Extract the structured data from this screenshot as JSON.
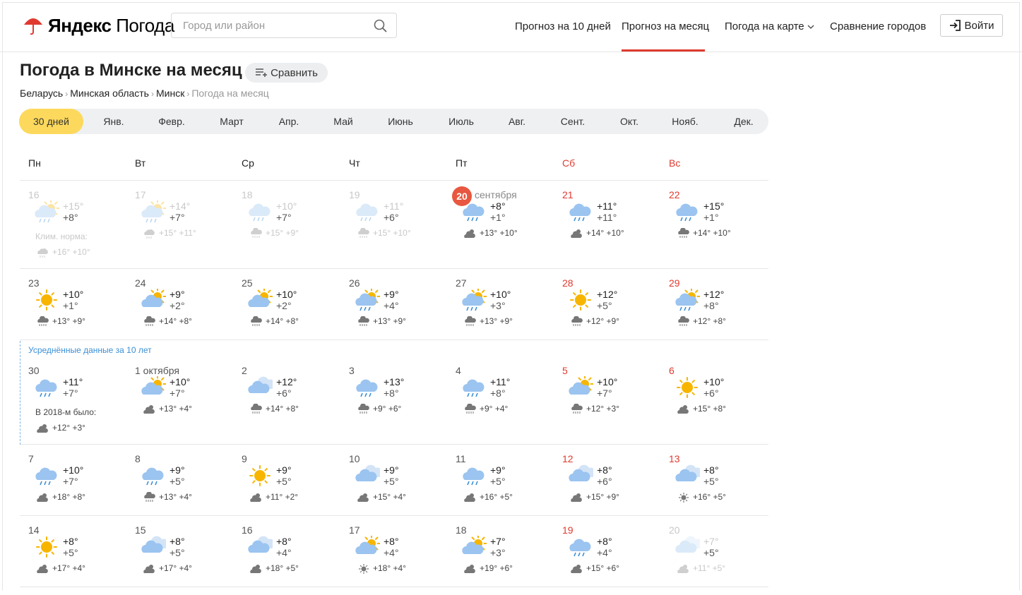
{
  "header": {
    "logo_brand": "Яндекс",
    "logo_service": "Погода",
    "search_placeholder": "Город или район",
    "nav": [
      "Прогноз на 10 дней",
      "Прогноз на месяц",
      "Погода на карте",
      "Сравнение городов"
    ],
    "login": "Войти"
  },
  "page": {
    "title": "Погода в Минске на месяц",
    "compare_label": "Сравнить",
    "breadcrumbs": [
      "Беларусь",
      "Минская область",
      "Минск",
      "Погода на месяц"
    ]
  },
  "months": [
    "30 дней",
    "Янв.",
    "Февр.",
    "Март",
    "Апр.",
    "Май",
    "Июнь",
    "Июль",
    "Авг.",
    "Сент.",
    "Окт.",
    "Нояб.",
    "Дек."
  ],
  "weekdays": [
    "Пн",
    "Вт",
    "Ср",
    "Чт",
    "Пт",
    "Сб",
    "Вс"
  ],
  "avg_label": "Усреднённые данные за 10 лет",
  "clim_label": "Клим. норма:",
  "clim_values": "+16° +10°",
  "past_year_label": "В 2018-м было:",
  "past_year_values": "+12° +3°",
  "today_month": "сентября",
  "colors": {
    "accent_yellow": "#fcd95c",
    "weekend_red": "#e03a2f",
    "today_badge": "#e8573f",
    "avg_blue": "#3b8fd6"
  },
  "weeks": [
    [
      {
        "n": "16",
        "d": "+15°",
        "nt": "+8°",
        "s": "",
        "i": "partly-cloudy-rain",
        "si": "sun-cloud-rain",
        "past": true
      },
      {
        "n": "17",
        "d": "+14°",
        "nt": "+7°",
        "s": "+15° +11°",
        "i": "partly-cloudy-rain",
        "si": "sun-cloud-rain",
        "past": true
      },
      {
        "n": "18",
        "d": "+10°",
        "nt": "+7°",
        "s": "+15° +9°",
        "i": "cloud-rain",
        "si": "cloud-rain",
        "past": true
      },
      {
        "n": "19",
        "d": "+11°",
        "nt": "+6°",
        "s": "+15° +10°",
        "i": "cloud-rain",
        "si": "cloud-rain",
        "past": true
      },
      {
        "n": "20",
        "d": "+8°",
        "nt": "+1°",
        "s": "+13° +10°",
        "i": "cloud-rain",
        "si": "sun-cloud",
        "today": true
      },
      {
        "n": "21",
        "d": "+11°",
        "nt": "+11°",
        "s": "+14° +10°",
        "i": "cloud-rain",
        "si": "sun-cloud"
      },
      {
        "n": "22",
        "d": "+15°",
        "nt": "+1°",
        "s": "+14° +10°",
        "i": "cloud-rain",
        "si": "cloud-rain"
      }
    ],
    [
      {
        "n": "23",
        "d": "+10°",
        "nt": "+1°",
        "s": "+13° +9°",
        "i": "sun",
        "si": "cloud-rain"
      },
      {
        "n": "24",
        "d": "+9°",
        "nt": "+2°",
        "s": "+14° +8°",
        "i": "partly-cloudy",
        "si": "cloud-rain"
      },
      {
        "n": "25",
        "d": "+10°",
        "nt": "+2°",
        "s": "+14° +8°",
        "i": "partly-cloudy",
        "si": "cloud-rain"
      },
      {
        "n": "26",
        "d": "+9°",
        "nt": "+4°",
        "s": "+13° +9°",
        "i": "partly-cloudy-rain",
        "si": "cloud-rain"
      },
      {
        "n": "27",
        "d": "+10°",
        "nt": "+3°",
        "s": "+13° +9°",
        "i": "partly-cloudy-rain",
        "si": "cloud-rain"
      },
      {
        "n": "28",
        "d": "+12°",
        "nt": "+5°",
        "s": "+12° +9°",
        "i": "sun",
        "si": "cloud-rain"
      },
      {
        "n": "29",
        "d": "+12°",
        "nt": "+8°",
        "s": "+12° +8°",
        "i": "partly-cloudy-rain",
        "si": "cloud-rain"
      }
    ],
    [
      {
        "n": "30",
        "d": "+11°",
        "nt": "+7°",
        "s": "",
        "i": "cloud-rain",
        "si": "sun-cloud"
      },
      {
        "n": "1 октября",
        "d": "+10°",
        "nt": "+7°",
        "s": "+13° +4°",
        "i": "partly-cloudy",
        "si": "sun-cloud"
      },
      {
        "n": "2",
        "d": "+12°",
        "nt": "+6°",
        "s": "+14° +8°",
        "i": "cloudy",
        "si": "cloud-rain"
      },
      {
        "n": "3",
        "d": "+13°",
        "nt": "+8°",
        "s": "+9° +6°",
        "i": "cloud-rain",
        "si": "cloud-rain"
      },
      {
        "n": "4",
        "d": "+11°",
        "nt": "+8°",
        "s": "+9° +4°",
        "i": "cloud-rain",
        "si": "cloud-rain"
      },
      {
        "n": "5",
        "d": "+10°",
        "nt": "+7°",
        "s": "+12° +3°",
        "i": "partly-cloudy",
        "si": "cloud-rain"
      },
      {
        "n": "6",
        "d": "+10°",
        "nt": "+6°",
        "s": "+15° +8°",
        "i": "sun",
        "si": "sun-cloud"
      }
    ],
    [
      {
        "n": "7",
        "d": "+10°",
        "nt": "+7°",
        "s": "+18° +8°",
        "i": "cloud-rain",
        "si": "sun-cloud"
      },
      {
        "n": "8",
        "d": "+9°",
        "nt": "+5°",
        "s": "+13° +4°",
        "i": "cloud-rain",
        "si": "cloud-rain"
      },
      {
        "n": "9",
        "d": "+9°",
        "nt": "+5°",
        "s": "+11° +2°",
        "i": "sun",
        "si": "sun-cloud"
      },
      {
        "n": "10",
        "d": "+9°",
        "nt": "+5°",
        "s": "+15° +4°",
        "i": "cloudy",
        "si": "sun-cloud"
      },
      {
        "n": "11",
        "d": "+9°",
        "nt": "+5°",
        "s": "+16° +5°",
        "i": "cloud-rain",
        "si": "sun-cloud"
      },
      {
        "n": "12",
        "d": "+8°",
        "nt": "+6°",
        "s": "+15° +9°",
        "i": "cloudy",
        "si": "sun-cloud"
      },
      {
        "n": "13",
        "d": "+8°",
        "nt": "+5°",
        "s": "+16° +5°",
        "i": "cloudy",
        "si": "sun"
      }
    ],
    [
      {
        "n": "14",
        "d": "+8°",
        "nt": "+5°",
        "s": "+17° +4°",
        "i": "sun",
        "si": "sun-cloud"
      },
      {
        "n": "15",
        "d": "+8°",
        "nt": "+5°",
        "s": "+17° +4°",
        "i": "cloudy",
        "si": "sun-cloud"
      },
      {
        "n": "16",
        "d": "+8°",
        "nt": "+4°",
        "s": "+18° +5°",
        "i": "cloudy",
        "si": "sun-cloud"
      },
      {
        "n": "17",
        "d": "+8°",
        "nt": "+4°",
        "s": "+18° +4°",
        "i": "partly-cloudy",
        "si": "sun"
      },
      {
        "n": "18",
        "d": "+7°",
        "nt": "+3°",
        "s": "+19° +6°",
        "i": "partly-cloudy",
        "si": "sun-cloud"
      },
      {
        "n": "19",
        "d": "+8°",
        "nt": "+4°",
        "s": "+15° +6°",
        "i": "cloud-rain",
        "si": "sun-cloud"
      },
      {
        "n": "20",
        "d": "+7°",
        "nt": "+5°",
        "s": "+11° +5°",
        "i": "cloudy",
        "si": "sun-cloud",
        "past": true
      }
    ]
  ]
}
